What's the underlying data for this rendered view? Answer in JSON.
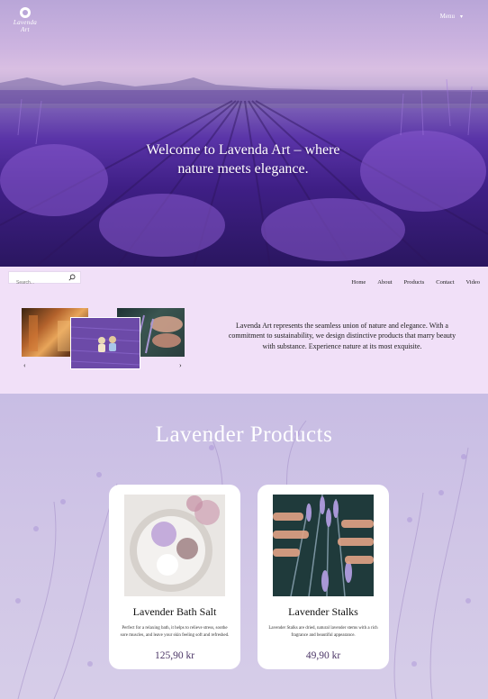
{
  "header": {
    "logo_text": "Lavenda Art",
    "menu_label": "Menu"
  },
  "hero": {
    "title": "Welcome to Lavenda Art – where nature meets elegance."
  },
  "search": {
    "placeholder": "Search..."
  },
  "nav": {
    "items": [
      "Home",
      "About",
      "Products",
      "Contact",
      "Video"
    ]
  },
  "gallery": {
    "prev": "‹",
    "next": "›"
  },
  "intro": {
    "text": "Lavenda Art represents the seamless union of nature and elegance. With a commitment to sustainability, we design distinctive products that marry beauty with substance. Experience nature at its most exquisite."
  },
  "products": {
    "title": "Lavender Products",
    "items": [
      {
        "name": "Lavender Bath Salt",
        "description": "Perfect for a relaxing bath, it helps to relieve stress, soothe sore muscles, and leave your skin feeling soft and refreshed.",
        "price": "125,90 kr"
      },
      {
        "name": "Lavender Stalks",
        "description": "Lavender Stalks are dried, natural lavender stems with a rich fragrance and beautiful appearance.",
        "price": "49,90 kr"
      }
    ]
  },
  "colors": {
    "hero_sky": "#cdb4e0",
    "lavender_field": "#5a34a8",
    "intro_bg": "#f1e0f8",
    "products_bg": "#c8bde4",
    "price": "#4b3566"
  }
}
